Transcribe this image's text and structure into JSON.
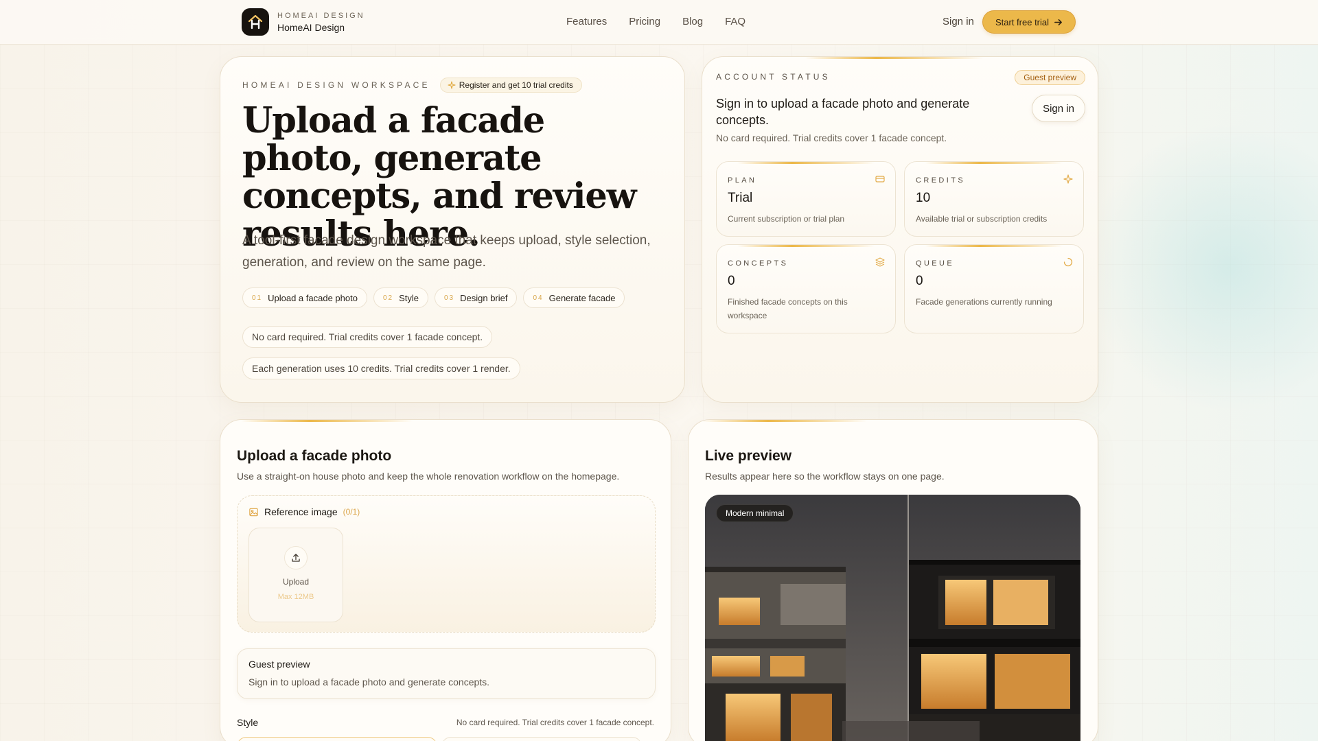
{
  "header": {
    "brand_kicker": "HOMEAI DESIGN",
    "brand_name": "HomeAI Design",
    "nav": [
      "Features",
      "Pricing",
      "Blog",
      "FAQ"
    ],
    "signin": "Sign in",
    "cta": "Start free trial"
  },
  "hero": {
    "eyebrow": "HOMEAI DESIGN WORKSPACE",
    "credit_pill": "Register and get 10 trial credits",
    "title": "Upload a facade photo, generate concepts, and review results here.",
    "description": "A tool-first facade design workspace that keeps upload, style selection, generation, and review on the same page.",
    "steps": [
      {
        "num": "01",
        "label": "Upload a facade photo"
      },
      {
        "num": "02",
        "label": "Style"
      },
      {
        "num": "03",
        "label": "Design brief"
      },
      {
        "num": "04",
        "label": "Generate facade"
      }
    ],
    "notes": [
      "No card required. Trial credits cover 1 facade concept.",
      "Each generation uses 10 credits. Trial credits cover 1 render."
    ]
  },
  "account": {
    "eyebrow": "ACCOUNT STATUS",
    "badge": "Guest preview",
    "title": "Sign in to upload a facade photo and generate concepts.",
    "subtitle": "No card required. Trial credits cover 1 facade concept.",
    "signin": "Sign in",
    "stats": [
      {
        "label": "PLAN",
        "value": "Trial",
        "desc": "Current subscription or trial plan",
        "icon": "card-icon"
      },
      {
        "label": "CREDITS",
        "value": "10",
        "desc": "Available trial or subscription credits",
        "icon": "sparkle-icon"
      },
      {
        "label": "CONCEPTS",
        "value": "0",
        "desc": "Finished facade concepts on this workspace",
        "icon": "layers-icon"
      },
      {
        "label": "QUEUE",
        "value": "0",
        "desc": "Facade generations currently running",
        "icon": "loader-icon"
      }
    ]
  },
  "upload": {
    "title": "Upload a facade photo",
    "subtitle": "Use a straight-on house photo and keep the whole renovation workflow on the homepage.",
    "ref_label": "Reference image",
    "ref_count": "(0/1)",
    "upload_label": "Upload",
    "upload_max": "Max 12MB",
    "guest_title": "Guest preview",
    "guest_sub": "Sign in to upload a facade photo and generate concepts.",
    "style_label": "Style",
    "style_note": "No card required. Trial credits cover 1 facade concept."
  },
  "preview": {
    "title": "Live preview",
    "subtitle": "Results appear here so the workflow stays on one page.",
    "style_tag": "Modern minimal"
  },
  "colors": {
    "accent": "#ecb84a",
    "accent_text": "#a35f10",
    "ink": "#17130f"
  }
}
